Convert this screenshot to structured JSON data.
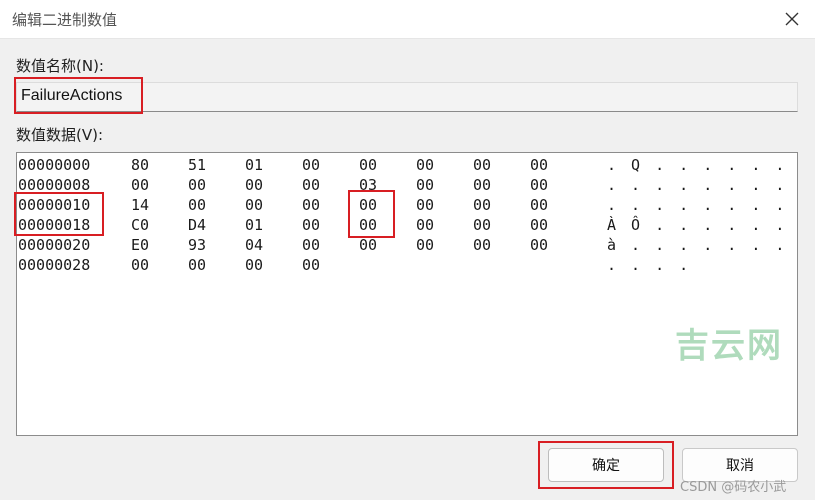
{
  "window": {
    "title": "编辑二进制数值"
  },
  "value_name": {
    "label": "数值名称(N):",
    "value": "FailureActions"
  },
  "value_data": {
    "label": "数值数据(V):",
    "rows": [
      {
        "offset": "00000000",
        "bytes": [
          "80",
          "51",
          "01",
          "00",
          "00",
          "00",
          "00",
          "00"
        ],
        "ascii": ". Q . . . . . ."
      },
      {
        "offset": "00000008",
        "bytes": [
          "00",
          "00",
          "00",
          "00",
          "03",
          "00",
          "00",
          "00"
        ],
        "ascii": ". . . . . . . ."
      },
      {
        "offset": "00000010",
        "bytes": [
          "14",
          "00",
          "00",
          "00",
          "00",
          "00",
          "00",
          "00"
        ],
        "ascii": ". . . . . . . ."
      },
      {
        "offset": "00000018",
        "bytes": [
          "C0",
          "D4",
          "01",
          "00",
          "00",
          "00",
          "00",
          "00"
        ],
        "ascii": "À Ô . . . . . ."
      },
      {
        "offset": "00000020",
        "bytes": [
          "E0",
          "93",
          "04",
          "00",
          "00",
          "00",
          "00",
          "00"
        ],
        "ascii": "à . . . . . . ."
      },
      {
        "offset": "00000028",
        "bytes": [
          "00",
          "00",
          "00",
          "00"
        ],
        "ascii": ". . . ."
      }
    ]
  },
  "buttons": {
    "ok": "确定",
    "cancel": "取消"
  },
  "watermark": {
    "site": "吉云网",
    "credit": "CSDN @码农小武"
  },
  "colors": {
    "highlight": "#d81e23",
    "watermark": "#6fbf86"
  }
}
